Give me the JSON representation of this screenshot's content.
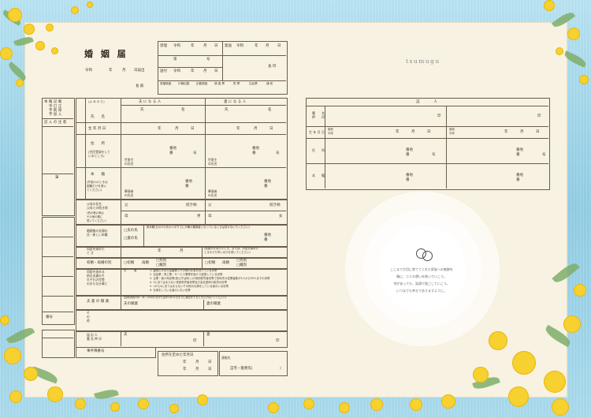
{
  "form": {
    "title": "婚 姻 届",
    "date_prefix": "令和",
    "date_units": [
      "年",
      "月",
      "日届出"
    ],
    "recipient": "長 殿",
    "receipt": {
      "received_label": "受理",
      "received_era": "令和",
      "units": [
        "年",
        "月",
        "日"
      ],
      "number_label": "第",
      "number_suffix": "号",
      "sent_label": "送付",
      "sent_era": "令和",
      "sent_label2": "発送",
      "sent_era2": "令和",
      "chief": "長 印",
      "sub_headers": [
        "書類調査",
        "戸籍記載",
        "記載調査",
        "調 査 票",
        "附 票",
        "住民票",
        "通 知"
      ]
    },
    "parties": {
      "husband_header": "夫 に な る 人",
      "wife_header": "妻 に な る 人",
      "furigana": "(よ み か た)",
      "name_label": "氏　　名",
      "family_label": "氏",
      "given_label": "名",
      "birth_label": "生 年 月 日",
      "birth_units": [
        "年",
        "月",
        "日"
      ],
      "address_label": "住　　所",
      "address_note": "(住民登録をして\nいるところ)",
      "banchi": "番地",
      "ban": "番",
      "go": "号",
      "householder": "世帯主\nの氏名",
      "domicile_label": "本　　籍",
      "domicile_note": "(外国人のときは\n国籍だけを書い\nてください)",
      "head_of_family": "筆頭者\nの氏名",
      "parents_label": "父母の氏名\n父母との続き柄",
      "parents_note": "(他の養父母は\nその他の欄に\n書いてください)",
      "father": "父",
      "mother": "母",
      "relation": "続き柄",
      "male": "男",
      "female": "女"
    },
    "sections": {
      "new_surname": "婚姻後の夫婦の\n氏・新しい本籍",
      "husband_surname": "□夫の氏",
      "wife_surname": "□妻の氏",
      "new_domicile": "新本籍(左の☑の氏の人がすでに戸籍の筆頭者となっているときは書かないでください)",
      "cohabit_start": "同居を始めた\nと き",
      "cohabit_units": [
        "年",
        "月"
      ],
      "cohabit_note": "(結婚式をあげたとき、または、同居を始めた\nときのうち早いほうを書いてください)",
      "marriage_history": "初婚・再婚の別",
      "first_marriage": "□初婚",
      "remarriage": "再婚",
      "death": "□死別",
      "divorce": "□離別",
      "household_job": "同居を始める\n前の夫妻のそ\nれぞれの世帯\nのおもな仕事と",
      "job_options": [
        "1. 農業だけまたは農業とその他の仕事を持っている世帯",
        "2. 自由業・商工業・サービス業等を個人で経営している世帯",
        "3. 企業・個人商店等(官公庁は除く)の常用勤労者世帯で勤め先の従業者数が1人から99人までの世帯",
        "4. 3にあてはまらない常用勤労者世帯及び会社団体の役員の世帯",
        "5. 1から4にあてはまらないその他の仕事をしている者のいる世帯",
        "6. 仕事をしている者のいない世帯"
      ],
      "husband_label": "夫",
      "wife_label": "妻",
      "occupation": "夫 妻 の 職 業",
      "census_note": "(国勢調査の年…年…の4月1日から翌年3月31日までに届出をするときだけ書いてください)",
      "husband_job": "夫の職業",
      "wife_job": "妻の職業",
      "other": "そ\nの\n他",
      "applicant": "届 出 人\n署 名 押 印",
      "seal": "印",
      "phone": "事件簿番号",
      "left_labels": [
        "本 籍 記 載",
        "字 訂 正",
        "字 削 除",
        "字 加 入",
        "記 入 の 注 意",
        "筆",
        "番号"
      ],
      "residence_label": "住所を定めた年月日",
      "residence_units": [
        "年",
        "月",
        "日"
      ],
      "contact": "連絡先",
      "contact_detail": "自宅・勤務先(",
      "contact_close": ")"
    },
    "witness": {
      "header": "証　　　　人",
      "signature_label": "署　　名\n押　　印",
      "seal": "印",
      "birth_label": "生 年 月 日",
      "era_options": "昭和\n平成",
      "units": [
        "年",
        "月",
        "日"
      ],
      "address_label": "住　　所",
      "banchi": "番地",
      "ban": "番",
      "go": "号",
      "domicile_label": "本　　籍"
    },
    "brand": "tsumugu",
    "message": [
      "ここまで大切に育ててくれた家族への感謝を",
      "胸に、二人の想いを紡いでいこう。",
      "何があっても、笑顔で過ごしていこう。",
      "いつまでも幸せでありますように。"
    ]
  }
}
